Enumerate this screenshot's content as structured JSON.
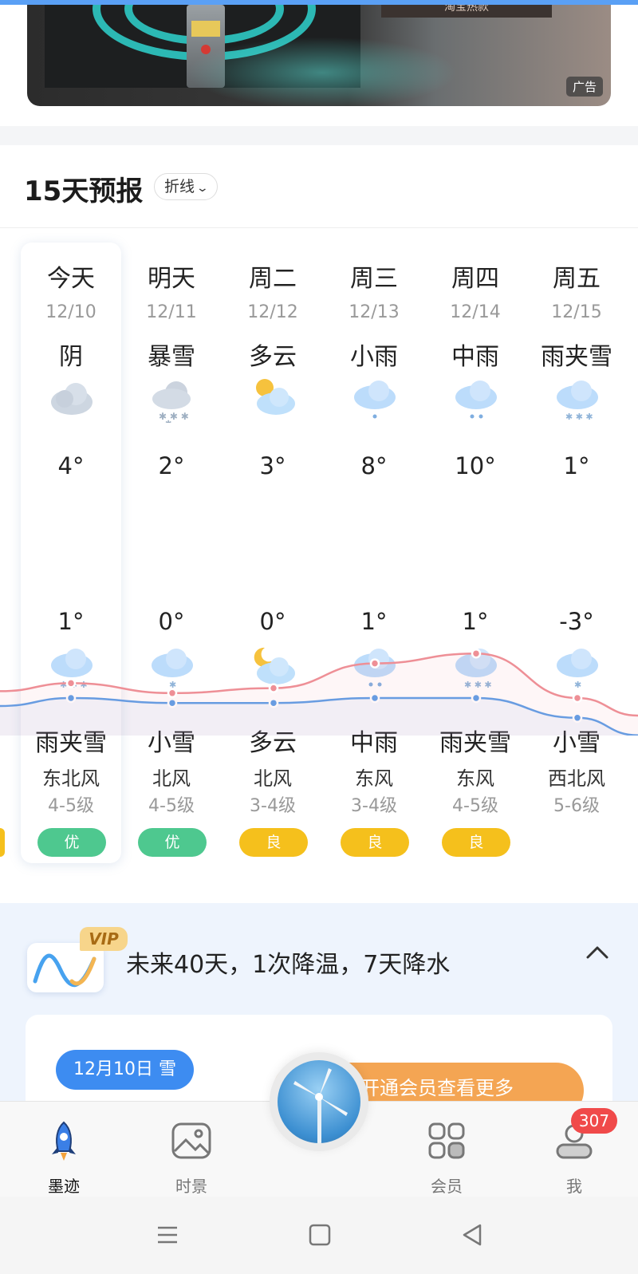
{
  "ad": {
    "tag": "广告",
    "banner_text": "淘宝热款"
  },
  "forecast": {
    "title": "15天预报",
    "mode": "折线",
    "days": [
      {
        "name": "今天",
        "date": "12/10",
        "day_wx": "阴",
        "day_icon": "overcast-icon",
        "high": "4°",
        "low": "1°",
        "night_icon": "sleet-icon",
        "night_wx": "雨夹雪",
        "wind_dir": "东北风",
        "wind_lvl": "4-5级",
        "aqi": "优",
        "aqi_level": "good"
      },
      {
        "name": "明天",
        "date": "12/11",
        "day_wx": "暴雪",
        "day_icon": "heavy-snow-icon",
        "high": "2°",
        "low": "0°",
        "night_icon": "light-snow-icon",
        "night_wx": "小雪",
        "wind_dir": "北风",
        "wind_lvl": "4-5级",
        "aqi": "优",
        "aqi_level": "good"
      },
      {
        "name": "周二",
        "date": "12/12",
        "day_wx": "多云",
        "day_icon": "partly-cloudy-day-icon",
        "high": "3°",
        "low": "0°",
        "night_icon": "partly-cloudy-night-icon",
        "night_wx": "多云",
        "wind_dir": "北风",
        "wind_lvl": "3-4级",
        "aqi": "良",
        "aqi_level": "moderate"
      },
      {
        "name": "周三",
        "date": "12/13",
        "day_wx": "小雨",
        "day_icon": "light-rain-icon",
        "high": "8°",
        "low": "1°",
        "night_icon": "moderate-rain-icon",
        "night_wx": "中雨",
        "wind_dir": "东风",
        "wind_lvl": "3-4级",
        "aqi": "良",
        "aqi_level": "moderate"
      },
      {
        "name": "周四",
        "date": "12/14",
        "day_wx": "中雨",
        "day_icon": "moderate-rain-icon",
        "high": "10°",
        "low": "1°",
        "night_icon": "sleet-icon",
        "night_wx": "雨夹雪",
        "wind_dir": "东风",
        "wind_lvl": "4-5级",
        "aqi": "良",
        "aqi_level": "moderate"
      },
      {
        "name": "周五",
        "date": "12/15",
        "day_wx": "雨夹雪",
        "day_icon": "sleet-icon",
        "high": "1°",
        "low": "-3°",
        "night_icon": "light-snow-icon",
        "night_wx": "小雪",
        "wind_dir": "西北风",
        "wind_lvl": "5-6级",
        "aqi": "",
        "aqi_level": ""
      }
    ],
    "colors": {
      "high_line": "#ee8f96",
      "low_line": "#5d9ee8",
      "aqi_good": "#4ec88f",
      "aqi_moderate": "#f5c01c"
    }
  },
  "vip": {
    "badge": "VIP",
    "summary": "未来40天，1次降温，7天降水",
    "date_pill": "12月10日 雪",
    "cta": "开通会员查看更多"
  },
  "nav": {
    "items": [
      {
        "label": "墨迹",
        "icon": "rocket-icon",
        "active": true
      },
      {
        "label": "时景",
        "icon": "gallery-icon",
        "active": false
      },
      {
        "label": "会员",
        "icon": "grid-icon",
        "active": false
      },
      {
        "label": "我",
        "icon": "profile-icon",
        "active": false
      }
    ],
    "badge_count": "307",
    "center_icon": "wind-turbine-icon"
  },
  "system_nav": {
    "icons": [
      "menu-icon",
      "home-icon",
      "back-icon"
    ]
  }
}
